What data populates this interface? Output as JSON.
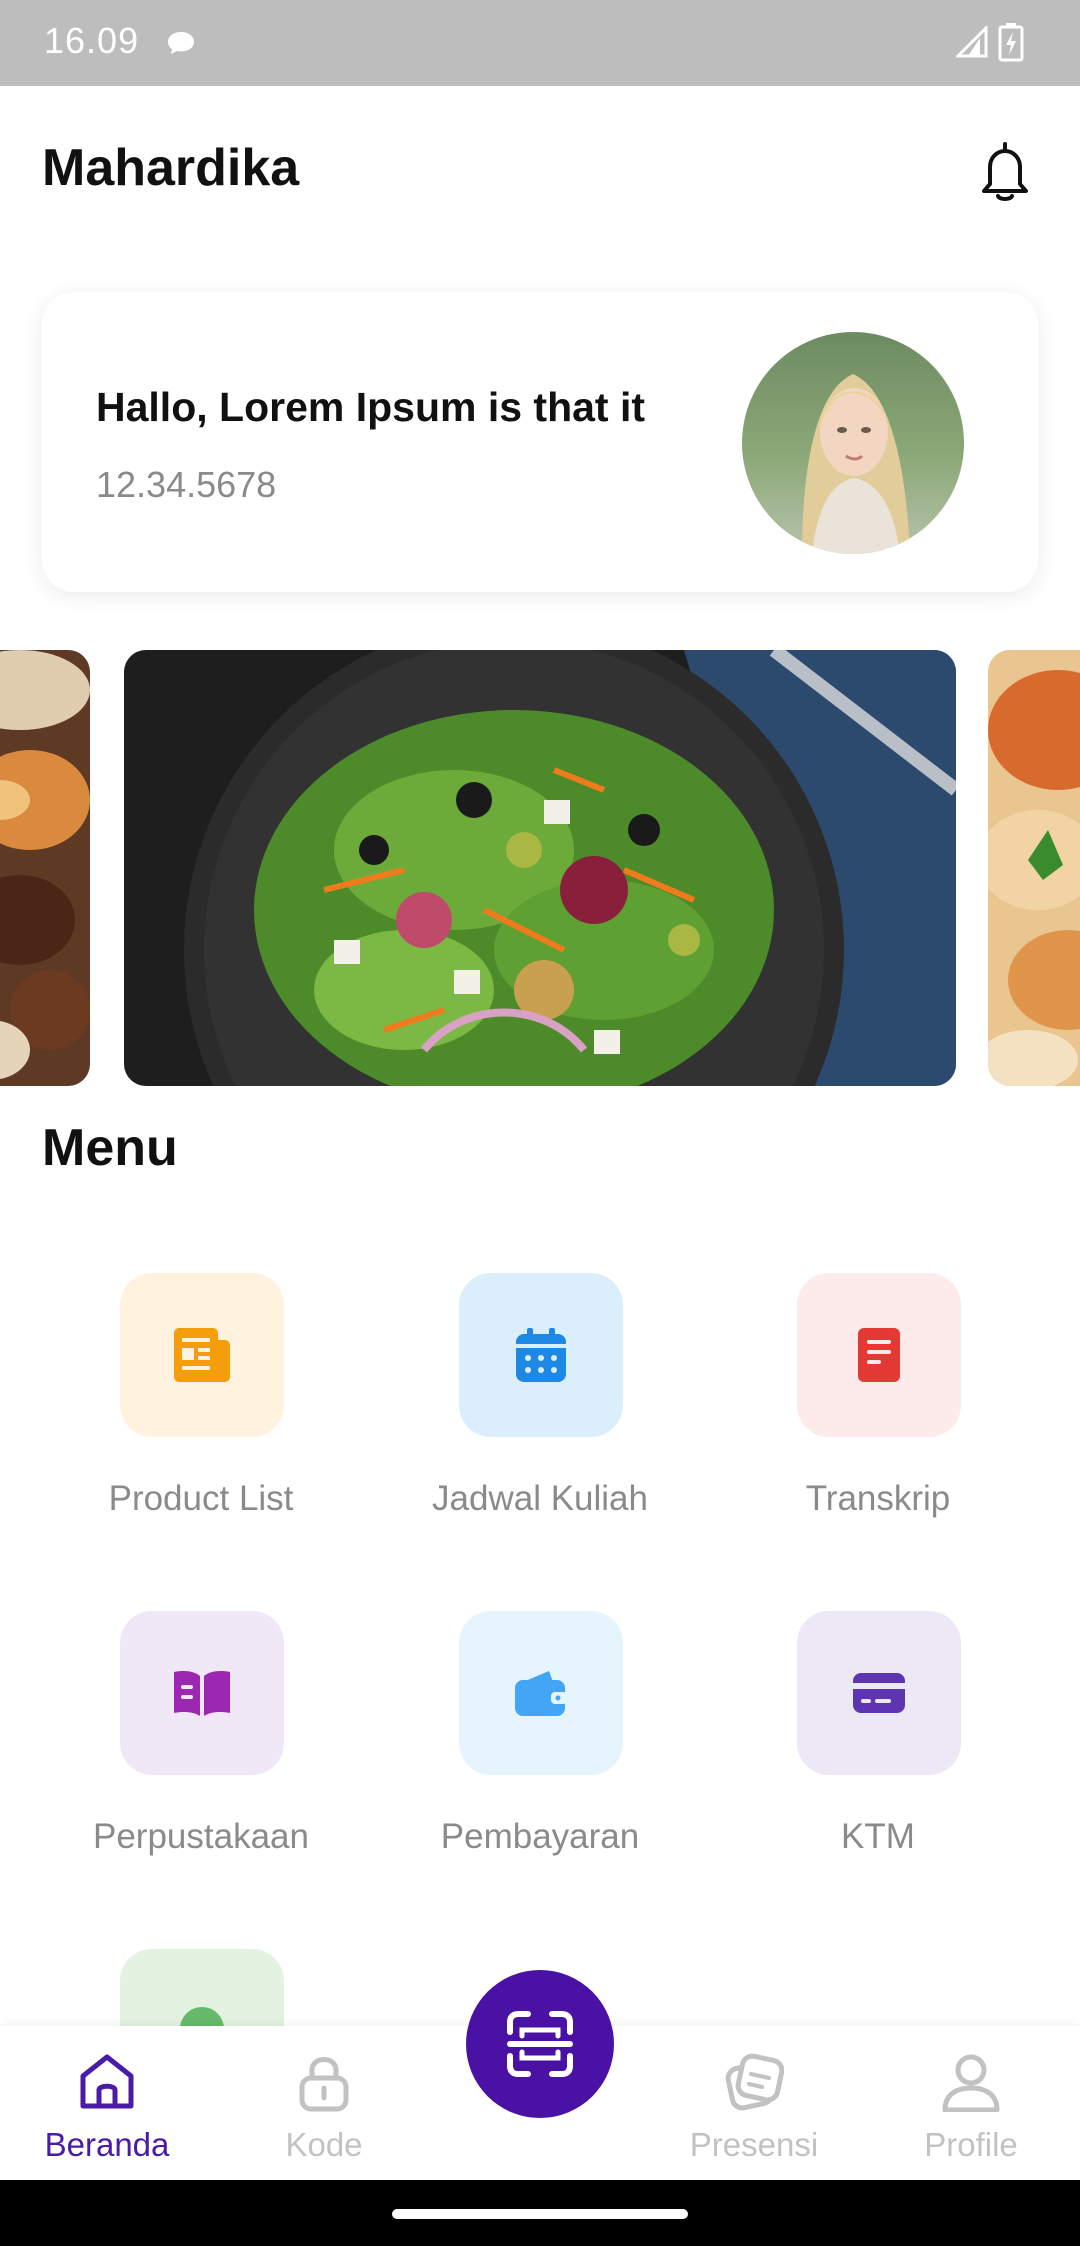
{
  "status_bar": {
    "time": "16.09"
  },
  "header": {
    "title": "Mahardika"
  },
  "profile": {
    "greeting": "Hallo, Lorem Ipsum is that it",
    "id_number": "12.34.5678"
  },
  "menu": {
    "title": "Menu",
    "items": [
      {
        "label": "Product List",
        "icon": "newspaper-icon",
        "tile_color": "#fff3e0",
        "icon_color": "#f59e0b"
      },
      {
        "label": "Jadwal Kuliah",
        "icon": "calendar-icon",
        "tile_color": "#dbeefb",
        "icon_color": "#1e88e5"
      },
      {
        "label": "Transkrip",
        "icon": "document-icon",
        "tile_color": "#fdeaea",
        "icon_color": "#e53935"
      },
      {
        "label": "Perpustakaan",
        "icon": "book-icon",
        "tile_color": "#f0e8f7",
        "icon_color": "#9c27b0"
      },
      {
        "label": "Pembayaran",
        "icon": "wallet-icon",
        "tile_color": "#e6f4fd",
        "icon_color": "#42a5f5"
      },
      {
        "label": "KTM",
        "icon": "card-icon",
        "tile_color": "#ece8f6",
        "icon_color": "#5e35b1"
      }
    ]
  },
  "bottom_nav": {
    "items": [
      {
        "label": "Beranda",
        "icon": "home-icon",
        "active": true
      },
      {
        "label": "Kode",
        "icon": "lock-icon",
        "active": false
      },
      {
        "label": "Presensi",
        "icon": "notes-icon",
        "active": false
      },
      {
        "label": "Profile",
        "icon": "user-icon",
        "active": false
      }
    ],
    "scan_icon": "scan-icon"
  },
  "colors": {
    "accent": "#4a12a4",
    "muted_text": "#8a8a8a",
    "inactive_nav": "#c2c2c2"
  }
}
